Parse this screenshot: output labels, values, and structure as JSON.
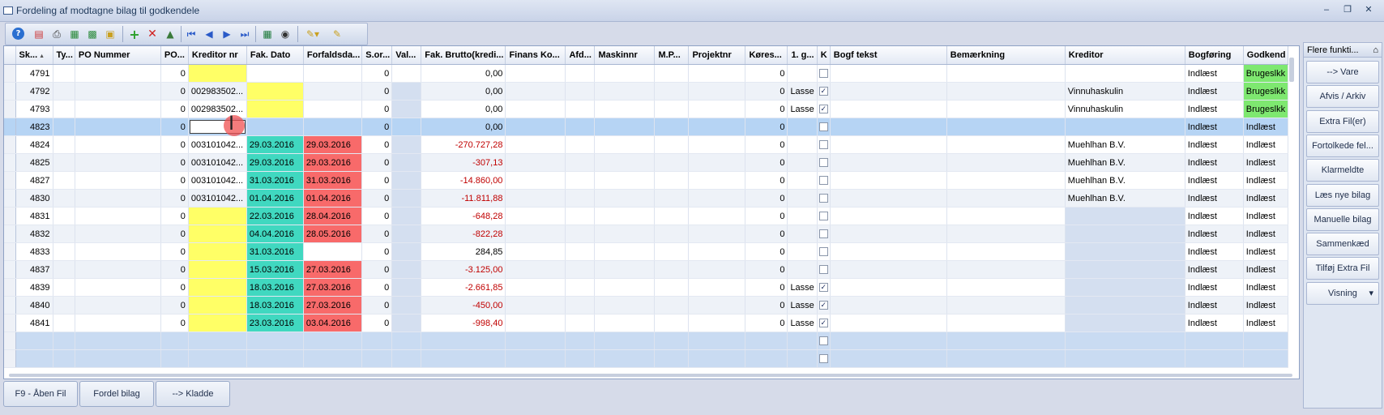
{
  "window": {
    "title": "Fordeling af modtagne bilag til godkendele"
  },
  "toolbar": {
    "icons": [
      "help-icon",
      "properties-icon",
      "print-icon",
      "export-icon",
      "import-icon",
      "lock-icon",
      "add-icon",
      "delete-icon",
      "attach-icon",
      "first-icon",
      "prev-icon",
      "next-icon",
      "last-icon",
      "excel-icon",
      "binoculars-icon",
      "dropdown-tool-icon",
      "edit-icon"
    ]
  },
  "grid": {
    "headers": [
      "Sk...",
      "Ty...",
      "PO Nummer",
      "PO...",
      "Kreditor nr",
      "Fak. Dato",
      "Forfaldsda...",
      "S.or...",
      "Val...",
      "Fak. Brutto(kredi...",
      "Finans Ko...",
      "Afd...",
      "Maskinnr",
      "M.P...",
      "Projektnr",
      "Køres...",
      "1. g...",
      "K",
      "Bogf tekst",
      "Bemærkning",
      "Kreditor",
      "Bogføring",
      "Godkend"
    ],
    "rows": [
      {
        "sk": "4791",
        "po": "0",
        "kred": "",
        "fakdato": "",
        "forf": "",
        "sor": "0",
        "val": "",
        "brutto": "0,00",
        "kores": "0",
        "g1": "",
        "k": false,
        "kreditor": "",
        "bogf": "Indlæst",
        "godk": "Brugeslkk"
      },
      {
        "sk": "4792",
        "po": "0",
        "kred": "002983502...",
        "fakdato": "",
        "forf": "",
        "sor": "0",
        "val": "",
        "brutto": "0,00",
        "kores": "0",
        "g1": "Lasse",
        "k": true,
        "kreditor": "Vinnuhaskulin",
        "bogf": "Indlæst",
        "godk": "Brugeslkk"
      },
      {
        "sk": "4793",
        "po": "0",
        "kred": "002983502...",
        "fakdato": "",
        "forf": "",
        "sor": "0",
        "val": "",
        "brutto": "0,00",
        "kores": "0",
        "g1": "Lasse",
        "k": true,
        "kreditor": "Vinnuhaskulin",
        "bogf": "Indlæst",
        "godk": "Brugeslkk"
      },
      {
        "sk": "4823",
        "po": "0",
        "kred": "",
        "fakdato": "",
        "forf": "",
        "sor": "0",
        "val": "",
        "brutto": "0,00",
        "kores": "0",
        "g1": "",
        "k": false,
        "kreditor": "",
        "bogf": "Indlæst",
        "godk": "Indlæst"
      },
      {
        "sk": "4824",
        "po": "0",
        "kred": "003101042...",
        "fakdato": "29.03.2016",
        "forf": "29.03.2016",
        "sor": "0",
        "val": "",
        "brutto": "-270.727,28",
        "kores": "0",
        "g1": "",
        "k": false,
        "kreditor": "Muehlhan B.V.",
        "bogf": "Indlæst",
        "godk": "Indlæst"
      },
      {
        "sk": "4825",
        "po": "0",
        "kred": "003101042...",
        "fakdato": "29.03.2016",
        "forf": "29.03.2016",
        "sor": "0",
        "val": "",
        "brutto": "-307,13",
        "kores": "0",
        "g1": "",
        "k": false,
        "kreditor": "Muehlhan B.V.",
        "bogf": "Indlæst",
        "godk": "Indlæst"
      },
      {
        "sk": "4827",
        "po": "0",
        "kred": "003101042...",
        "fakdato": "31.03.2016",
        "forf": "31.03.2016",
        "sor": "0",
        "val": "",
        "brutto": "-14.860,00",
        "kores": "0",
        "g1": "",
        "k": false,
        "kreditor": "Muehlhan B.V.",
        "bogf": "Indlæst",
        "godk": "Indlæst"
      },
      {
        "sk": "4830",
        "po": "0",
        "kred": "003101042...",
        "fakdato": "01.04.2016",
        "forf": "01.04.2016",
        "sor": "0",
        "val": "",
        "brutto": "-11.811,88",
        "kores": "0",
        "g1": "",
        "k": false,
        "kreditor": "Muehlhan B.V.",
        "bogf": "Indlæst",
        "godk": "Indlæst"
      },
      {
        "sk": "4831",
        "po": "0",
        "kred": "",
        "fakdato": "22.03.2016",
        "forf": "28.04.2016",
        "sor": "0",
        "val": "",
        "brutto": "-648,28",
        "kores": "0",
        "g1": "",
        "k": false,
        "kreditor": "",
        "bogf": "Indlæst",
        "godk": "Indlæst"
      },
      {
        "sk": "4832",
        "po": "0",
        "kred": "",
        "fakdato": "04.04.2016",
        "forf": "28.05.2016",
        "sor": "0",
        "val": "",
        "brutto": "-822,28",
        "kores": "0",
        "g1": "",
        "k": false,
        "kreditor": "",
        "bogf": "Indlæst",
        "godk": "Indlæst"
      },
      {
        "sk": "4833",
        "po": "0",
        "kred": "",
        "fakdato": "31.03.2016",
        "forf": "",
        "sor": "0",
        "val": "",
        "brutto": "284,85",
        "kores": "0",
        "g1": "",
        "k": false,
        "kreditor": "",
        "bogf": "Indlæst",
        "godk": "Indlæst"
      },
      {
        "sk": "4837",
        "po": "0",
        "kred": "",
        "fakdato": "15.03.2016",
        "forf": "27.03.2016",
        "sor": "0",
        "val": "",
        "brutto": "-3.125,00",
        "kores": "0",
        "g1": "",
        "k": false,
        "kreditor": "",
        "bogf": "Indlæst",
        "godk": "Indlæst"
      },
      {
        "sk": "4839",
        "po": "0",
        "kred": "",
        "fakdato": "18.03.2016",
        "forf": "27.03.2016",
        "sor": "0",
        "val": "",
        "brutto": "-2.661,85",
        "kores": "0",
        "g1": "Lasse",
        "k": true,
        "kreditor": "",
        "bogf": "Indlæst",
        "godk": "Indlæst"
      },
      {
        "sk": "4840",
        "po": "0",
        "kred": "",
        "fakdato": "18.03.2016",
        "forf": "27.03.2016",
        "sor": "0",
        "val": "",
        "brutto": "-450,00",
        "kores": "0",
        "g1": "Lasse",
        "k": true,
        "kreditor": "",
        "bogf": "Indlæst",
        "godk": "Indlæst"
      },
      {
        "sk": "4841",
        "po": "0",
        "kred": "",
        "fakdato": "23.03.2016",
        "forf": "03.04.2016",
        "sor": "0",
        "val": "",
        "brutto": "-998,40",
        "kores": "0",
        "g1": "Lasse",
        "k": true,
        "kreditor": "",
        "bogf": "Indlæst",
        "godk": "Indlæst"
      }
    ],
    "empty_rows": 2
  },
  "bottom_buttons": [
    "F9 - Åben Fil",
    "Fordel bilag",
    "--> Kladde"
  ],
  "side_panel": {
    "header": "Flere funkti...",
    "buttons": [
      "--> Vare",
      "Afvis / Arkiv",
      "Extra Fil(er)",
      "Fortolkede fel...",
      "Klarmeldte",
      "Læs nye bilag",
      "Manuelle bilag",
      "Sammenkæd",
      "Tilføj Extra Fil",
      "Visning"
    ]
  },
  "colors": {
    "yellow": "#ffff66",
    "teal": "#40d8c0",
    "red": "#f86a6a",
    "green": "#7ee870",
    "selected": "#b6d4f4"
  }
}
